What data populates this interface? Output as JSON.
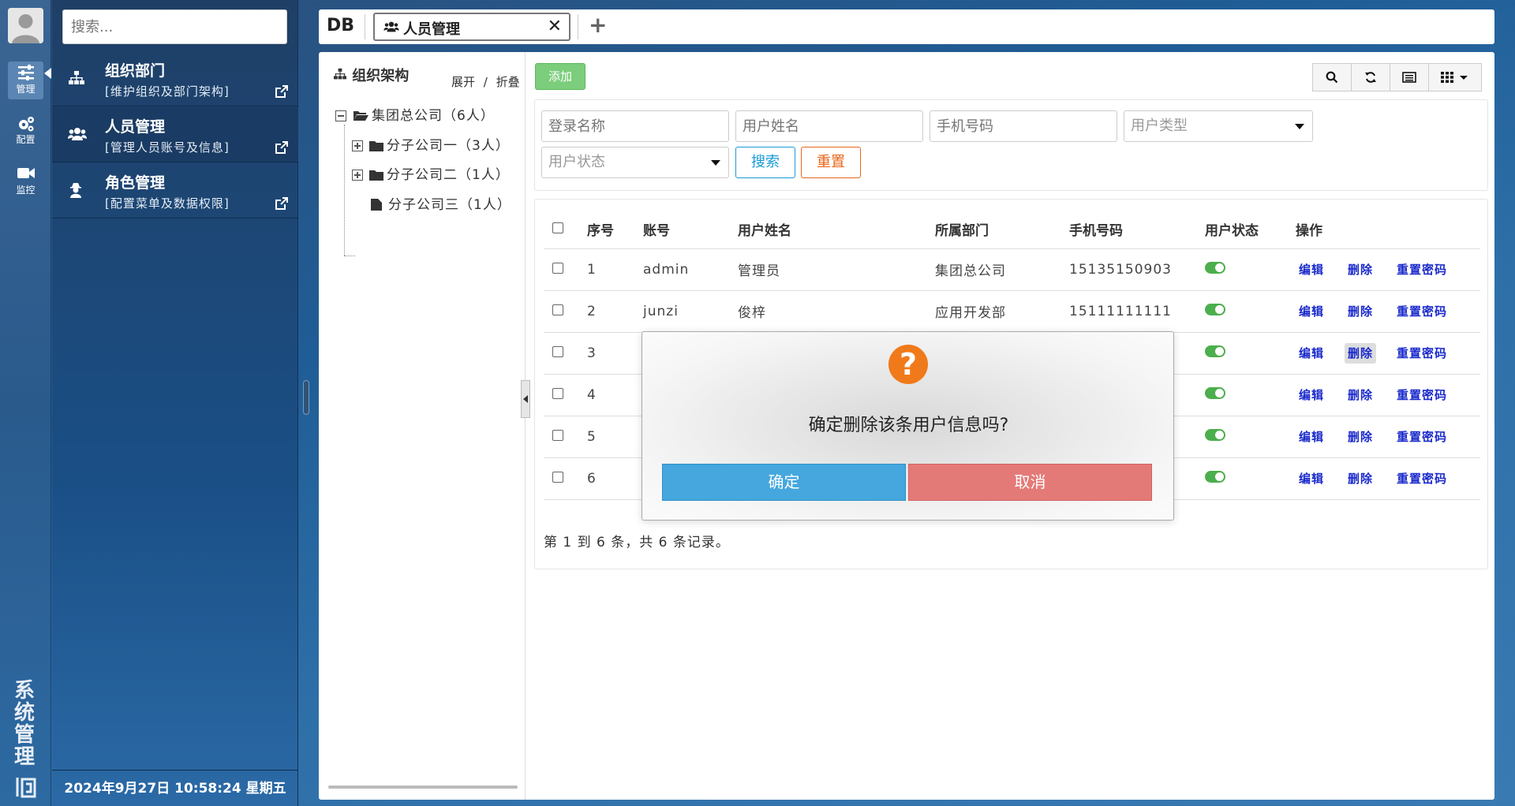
{
  "rail": {
    "items": [
      {
        "label": "管理",
        "icon": "sliders-icon"
      },
      {
        "label": "配置",
        "icon": "gears-icon"
      },
      {
        "label": "监控",
        "icon": "video-camera-icon"
      }
    ],
    "vertical_title": "系统管理"
  },
  "menu": {
    "search_placeholder": "搜索...",
    "items": [
      {
        "title": "组织部门",
        "desc": "[维护组织及部门架构]",
        "icon": "sitemap-icon"
      },
      {
        "title": "人员管理",
        "desc": "[管理人员账号及信息]",
        "icon": "users-icon"
      },
      {
        "title": "角色管理",
        "desc": "[配置菜单及数据权限]",
        "icon": "user-secret-icon"
      }
    ],
    "datetime": "2024年9月27日 10:58:24 星期五"
  },
  "tabbar": {
    "brand": "DB",
    "active_tab": "人员管理"
  },
  "tree": {
    "title": "组织架构",
    "expand": "展开",
    "separator": "/",
    "collapse": "折叠",
    "root": "集团总公司（6人）",
    "children": [
      "分子公司一（3人）",
      "分子公司二（1人）",
      "分子公司三（1人）"
    ]
  },
  "toolbar": {
    "add_label": "添加"
  },
  "filters": {
    "login_name": "登录名称",
    "user_name": "用户姓名",
    "phone": "手机号码",
    "user_type": "用户类型",
    "user_status": "用户状态",
    "search_label": "搜索",
    "reset_label": "重置"
  },
  "table": {
    "headers": [
      "序号",
      "账号",
      "用户姓名",
      "所属部门",
      "手机号码",
      "用户状态",
      "操作"
    ],
    "rows": [
      {
        "no": "1",
        "account": "admin",
        "name": "管理员",
        "dept": "集团总公司",
        "phone": "15135150903"
      },
      {
        "no": "2",
        "account": "junzi",
        "name": "俊梓",
        "dept": "应用开发部",
        "phone": "15111111111"
      },
      {
        "no": "3",
        "account": "",
        "name": "",
        "dept": "",
        "phone": ""
      },
      {
        "no": "4",
        "account": "",
        "name": "",
        "dept": "",
        "phone": ""
      },
      {
        "no": "5",
        "account": "",
        "name": "",
        "dept": "",
        "phone": ""
      },
      {
        "no": "6",
        "account": "",
        "name": "",
        "dept": "",
        "phone": ""
      }
    ],
    "actions": {
      "edit": "编辑",
      "delete": "删除",
      "reset_pwd": "重置密码"
    },
    "pager": "第 1 到 6 条，共 6 条记录。"
  },
  "modal": {
    "icon": "?",
    "message": "确定删除该条用户信息吗?",
    "ok_label": "确定",
    "cancel_label": "取消"
  },
  "colors": {
    "accent": "#1a9bd7",
    "add": "#7ccd7c",
    "ok": "#45a7dd",
    "cancel": "#e47a78",
    "warn": "#f07a1a",
    "status_on": "#4cae4c"
  }
}
